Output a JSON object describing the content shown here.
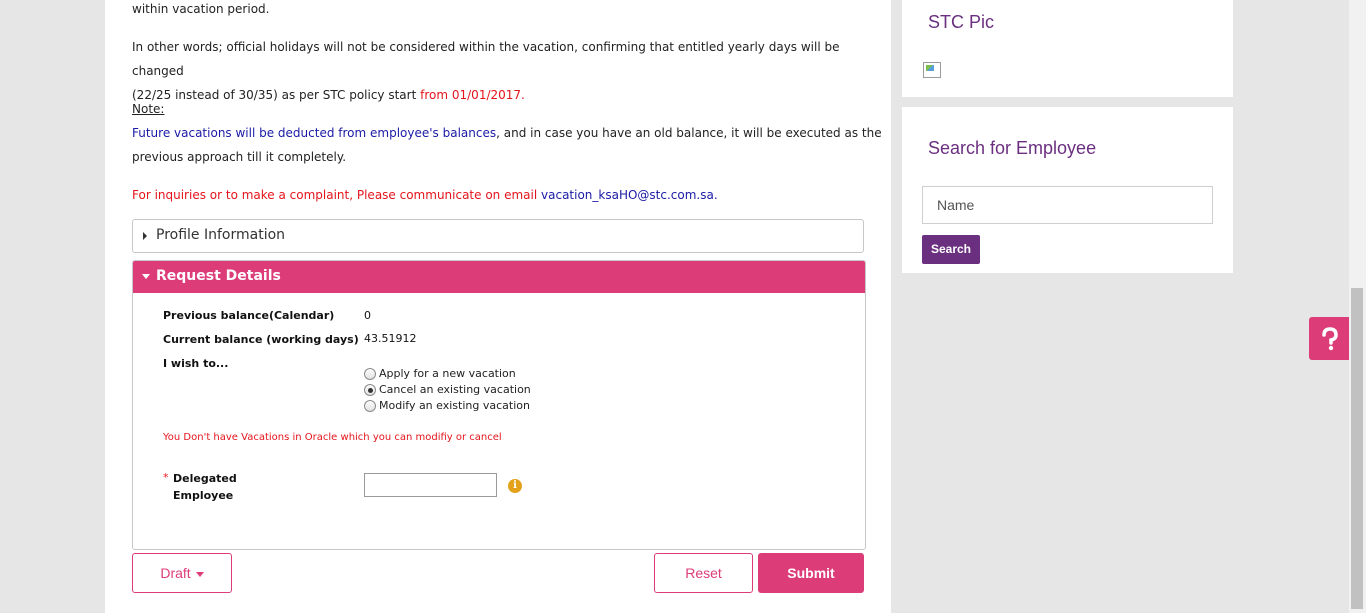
{
  "content": {
    "line_top": "within vacation period.",
    "para1_text": "In other words; official holidays will not be considered within the vacation, confirming that entitled yearly days will be changed",
    "para1_line2": "(22/25 instead of 30/35) as per STC policy start ",
    "para1_date": "from 01/01/2017.",
    "note_heading": "Note:",
    "note_blue": "Future vacations will be deducted from employee's balances",
    "note_rest": ", and in case you have an old balance, it will be executed as the",
    "note_line2": "previous approach till it completely.",
    "inquiry_text": "For inquiries or to make a complaint, Please communicate on email ",
    "inquiry_email": "vacation_ksaHO@stc.com.sa."
  },
  "profile_panel": {
    "title": "Profile Information"
  },
  "request_panel": {
    "title": "Request Details",
    "prev_balance_label": "Previous balance(Calendar)",
    "prev_balance_value": "0",
    "curr_balance_label": "Current balance (working days)",
    "curr_balance_value": "43.51912",
    "wish_label": "I wish to...",
    "options": [
      {
        "label": "Apply for a new vacation",
        "checked": false
      },
      {
        "label": "Cancel an existing vacation",
        "checked": true
      },
      {
        "label": "Modify an existing vacation",
        "checked": false
      }
    ],
    "error_text": "You Don't have Vacations in Oracle which you can modifiy or cancel",
    "required_mark": "*",
    "delegated_label_1": "Delegated",
    "delegated_label_2": "Employee",
    "delegated_value": "",
    "info_glyph": "i"
  },
  "actions": {
    "draft": "Draft",
    "reset": "Reset",
    "submit": "Submit"
  },
  "sidebar": {
    "pic_title": "STC Pic",
    "search_title": "Search for Employee",
    "name_placeholder": "Name",
    "search_button": "Search"
  },
  "colors": {
    "brand_pink": "#dc3d79",
    "brand_purple": "#6b2f80",
    "error_red": "#e4141c",
    "link_blue": "#1a1aa6"
  }
}
